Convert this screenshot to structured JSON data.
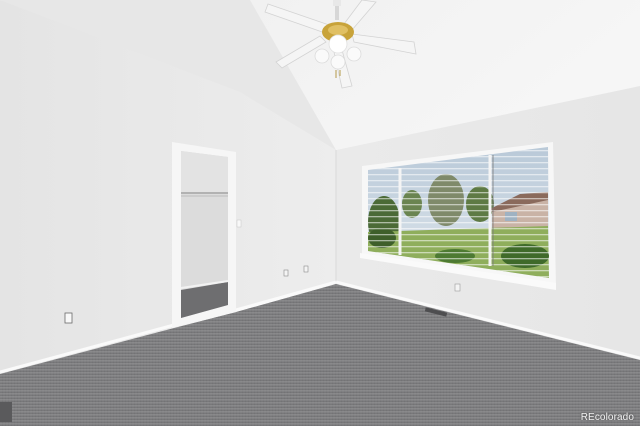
{
  "photo": {
    "subject": "empty-bedroom-interior"
  },
  "watermark": {
    "text": "REcolorado"
  },
  "colors": {
    "wall_left": "#e9e9e9",
    "wall_right": "#ececec",
    "ceiling": "#f2f2f2",
    "carpet": "#7e7e80",
    "window_frame": "#f7f7f7",
    "sky": "#c9d6e2",
    "tree": "#4f6f3a",
    "lawn": "#7fa055",
    "fan_brass": "#c8a33a"
  }
}
